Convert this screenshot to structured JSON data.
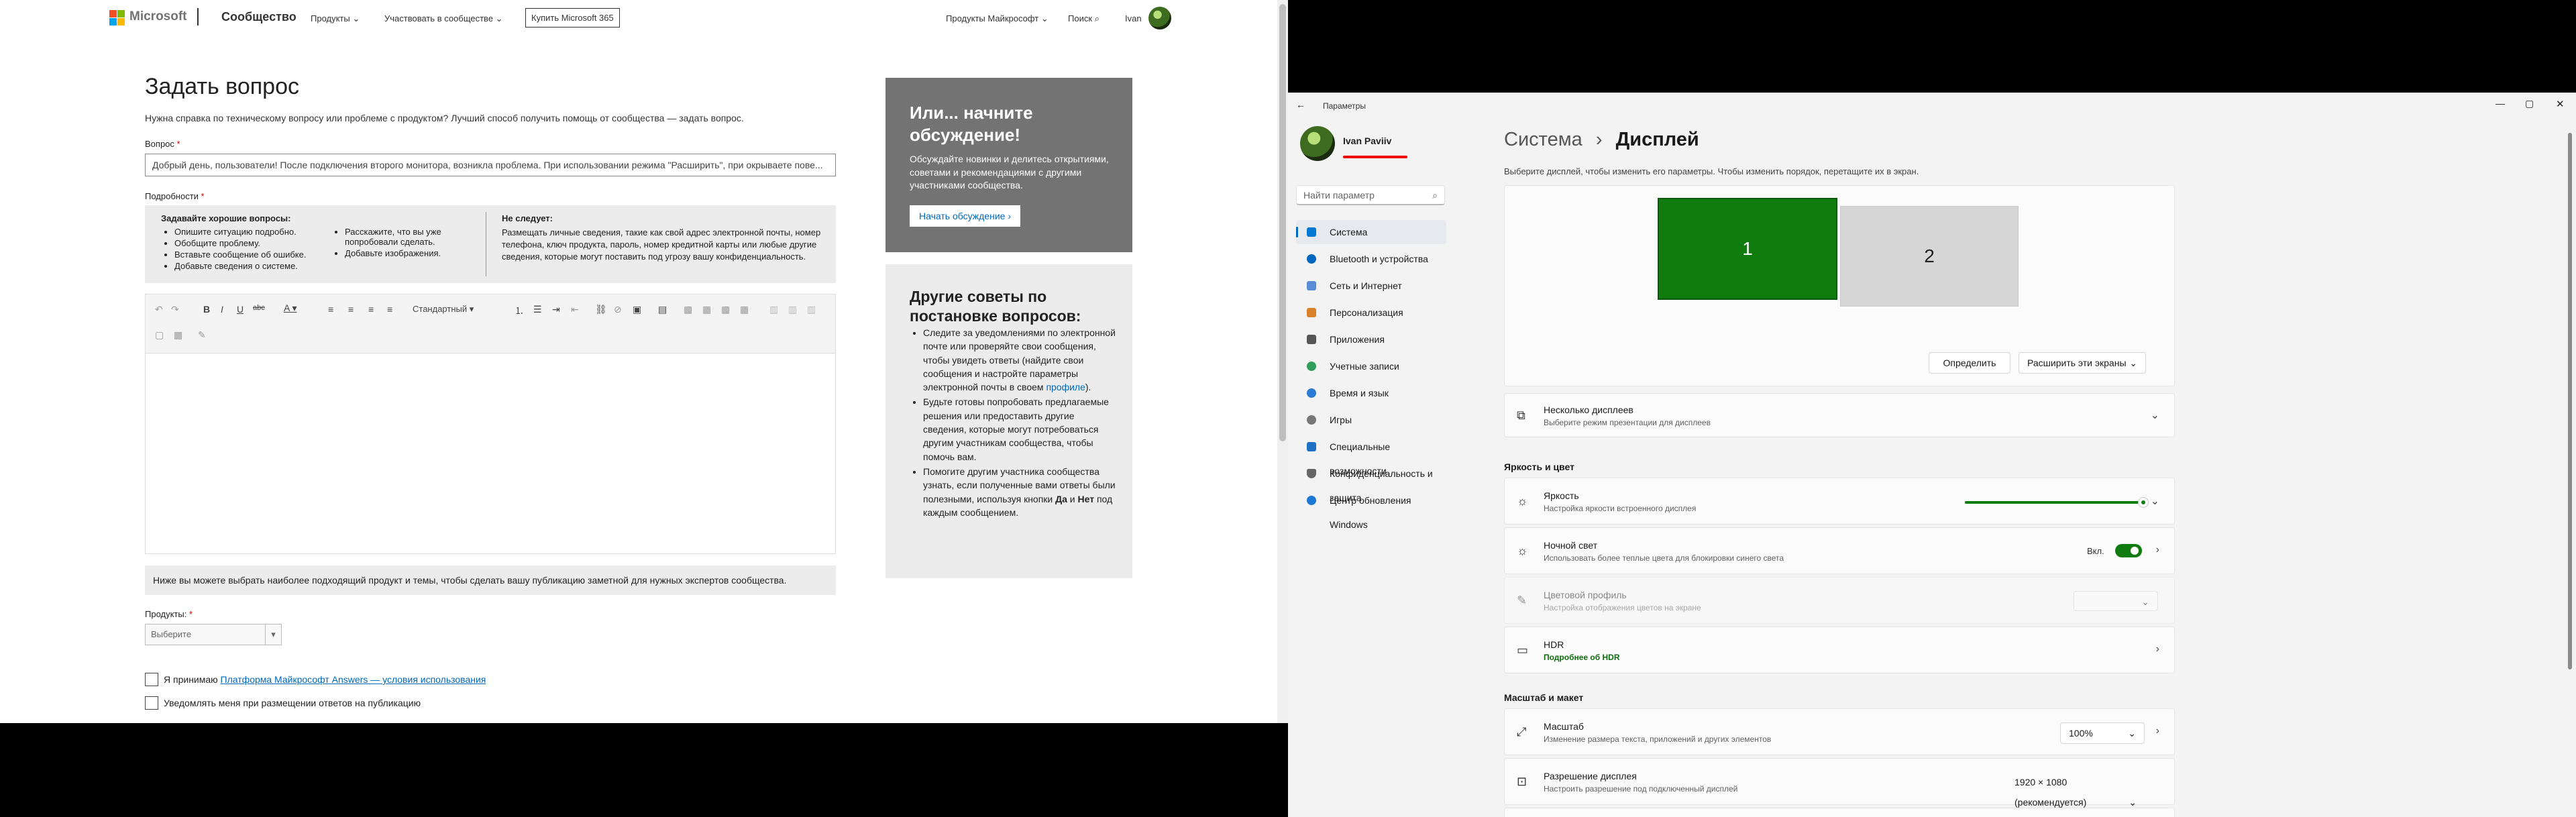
{
  "community": {
    "brand": "Microsoft",
    "site": "Сообщество",
    "nav": [
      "Продукты",
      "Участвовать в сообществе"
    ],
    "buy_button": "Купить Microsoft 365",
    "products_ms": "Продукты Майкрософт",
    "search": "Поиск",
    "user": "Ivan",
    "title": "Задать вопрос",
    "intro": "Нужна справка по техническому вопросу или проблеме с продуктом? Лучший способ получить помощь от сообщества — задать вопрос.",
    "question_label": "Вопрос",
    "question_value": "Добрый день, пользователи! После подключения второго монитора, возникла проблема. При использовании режима \"Расширить\", при окрываете пове...",
    "details_label": "Подробности",
    "good_title": "Задавайте хорошие вопросы:",
    "good_col1": [
      "Опишите ситуацию подробно.",
      "Обобщите проблему.",
      "Вставьте сообщение об ошибке.",
      "Добавьте сведения о системе."
    ],
    "good_col2": [
      "Расскажите, что вы уже попробовали сделать.",
      "Добавьте изображения."
    ],
    "bad_title": "Не следует:",
    "bad_text": "Размещать личные сведения, такие как свой адрес электронной почты, номер телефона, ключ продукта, пароль, номер кредитной карты или любые другие сведения, которые могут поставить под угрозу вашу конфиденциальность.",
    "style_select": "Стандартный",
    "below_text": "Ниже вы можете выбрать наиболее подходящий продукт и темы, чтобы сделать вашу публикацию заметной для нужных экспертов сообщества.",
    "products_label": "Продукты:",
    "products_placeholder": "Выберите",
    "accept_prefix": "Я принимаю",
    "accept_link": "Платформа Майкрософт Answers — условия использования",
    "notify": "Уведомлять меня при размещении ответов на публикацию",
    "discuss_title": "Или... начните обсуждение!",
    "discuss_text": "Обсуждайте новинки и делитесь открытиями, советами и рекомендациями с другими участниками сообщества.",
    "discuss_button": "Начать обсуждение",
    "tips_title": "Другие советы по постановке вопросов:",
    "tip1": "Следите за уведомлениями по электронной почте или проверяйте свои сообщения, чтобы увидеть ответы (найдите свои сообщения и настройте параметры электронной почты в своем",
    "tip1_link": "профиле",
    "tip2": "Будьте готовы попробовать предлагаемые решения или предоставить другие сведения, которые могут потребоваться другим участникам сообщества, чтобы помочь вам.",
    "tip3_a": "Помогите другим участника сообщества узнать, если полученные вами ответы были полезными, используя кнопки",
    "tip3_yes": "Да",
    "tip3_and": "и",
    "tip3_no": "Нет",
    "tip3_b": "под каждым сообщением."
  },
  "settings": {
    "app_title": "Параметры",
    "user_name": "Ivan Paviiv",
    "search_placeholder": "Найти параметр",
    "nav": [
      "Система",
      "Bluetooth и устройства",
      "Сеть и Интернет",
      "Персонализация",
      "Приложения",
      "Учетные записи",
      "Время и язык",
      "Игры",
      "Специальные возможности",
      "Конфиденциальность и защита",
      "Центр обновления Windows"
    ],
    "bc_parent": "Система",
    "bc_current": "Дисплей",
    "hint": "Выберите дисплей, чтобы изменить его параметры. Чтобы изменить порядок, перетащите их в экран.",
    "monitor1": "1",
    "monitor2": "2",
    "identify": "Определить",
    "extend": "Расширить эти экраны",
    "multi_title": "Несколько дисплеев",
    "multi_sub": "Выберите режим презентации для дисплеев",
    "brightness_section": "Яркость и цвет",
    "brightness_title": "Яркость",
    "brightness_sub": "Настройка яркости встроенного дисплея",
    "brightness_level": 1.0,
    "night_title": "Ночной свет",
    "night_sub": "Использовать более теплые цвета для блокировки синего света",
    "night_state": "Вкл.",
    "profile_title": "Цветовой профиль",
    "profile_sub": "Настройка отображения цветов на экране",
    "hdr_title": "HDR",
    "hdr_link": "Подробнее об HDR",
    "scale_section": "Масштаб и макет",
    "scale_title": "Масштаб",
    "scale_sub": "Изменение размера текста, приложений и других элементов",
    "scale_value": "100%",
    "res_title": "Разрешение дисплея",
    "res_sub": "Настроить разрешение под подключенный дисплей",
    "res_value": "1920 × 1080 (рекомендуется)"
  },
  "colors": {
    "accent_green": "#107c10",
    "ms_link": "#0067b8",
    "win_accent": "#0067c0"
  }
}
